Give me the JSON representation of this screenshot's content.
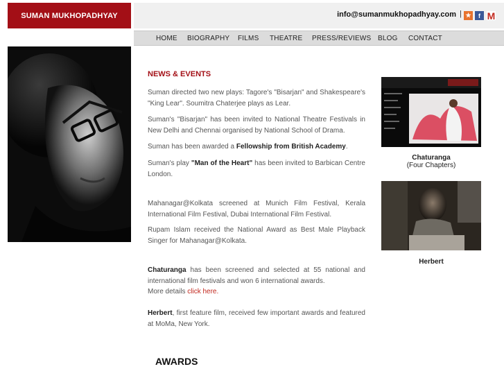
{
  "header": {
    "site_title": "SUMAN MUKHOPADHYAY",
    "email": "info@sumanmukhopadhyay.com",
    "separator": "|",
    "social": [
      {
        "icon": "star-bookmark-icon",
        "glyph": "★"
      },
      {
        "icon": "facebook-icon",
        "glyph": "f"
      },
      {
        "icon": "gmail-icon",
        "glyph": "M"
      }
    ]
  },
  "nav": {
    "items": [
      "HOME",
      "BIOGRAPHY",
      "FILMS",
      "THEATRE",
      "PRESS/REVIEWS",
      "BLOG",
      "CONTACT"
    ]
  },
  "news": {
    "title": "NEWS & EVENTS",
    "p1": "Suman directed two new plays: Tagore's \"Bisarjan\" and Shakespeare's \"King Lear\". Soumitra Chaterjee plays as Lear.",
    "p2": "Suman's \"Bisarjan\" has been invited to National Theatre Festivals in New Delhi and Chennai organised by National School of Drama.",
    "p3_pre": "Suman has been awarded a ",
    "p3_bold": "Fellowship from British Academy",
    "p3_post": ".",
    "p4_pre": "Suman's play ",
    "p4_bold": "\"Man of the Heart\"",
    "p4_post": " has been invited to Barbican Centre London.",
    "p5": "Mahanagar@Kolkata screened at Munich Film Festival, Kerala International Film Festival, Dubai International Film Festival.",
    "p6": "Rupam Islam received the National Award as Best Male Playback Singer for Mahanagar@Kolkata.",
    "p7_bold": "Chaturanga",
    "p7_post": " has been screened and selected at 55 national and international film festivals and won 6 international awards.",
    "p7_more": "More details ",
    "p7_link": "click here.",
    "p8_bold": "Herbert",
    "p8_post": ", first feature film, received few important awards and featured at MoMa, New York."
  },
  "awards": {
    "title": "AWARDS"
  },
  "sidebar": {
    "films": [
      {
        "title": "Chaturanga",
        "subtitle": "(Four Chapters)"
      },
      {
        "title": "Herbert",
        "subtitle": ""
      }
    ]
  }
}
